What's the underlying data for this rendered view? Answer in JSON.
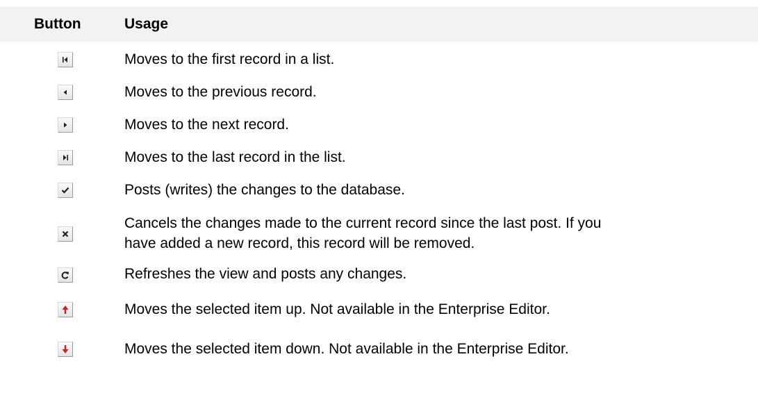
{
  "table": {
    "header": {
      "button": "Button",
      "usage": "Usage"
    },
    "rows": [
      {
        "icon": "first-record-icon",
        "usage": "Moves to the first record in a list."
      },
      {
        "icon": "prior-record-icon",
        "usage": "Moves to the previous record."
      },
      {
        "icon": "next-record-icon",
        "usage": "Moves to the next record."
      },
      {
        "icon": "last-record-icon",
        "usage": "Moves to the last record in the list."
      },
      {
        "icon": "post-checkmark-icon",
        "usage": "Posts (writes) the changes to the database."
      },
      {
        "icon": "cancel-x-icon",
        "usage_line1": "Cancels the changes made to the current record since the last post. If you",
        "usage_line2": "have added a new record, this record will be removed."
      },
      {
        "icon": "refresh-icon",
        "usage": "Refreshes the view and posts any changes."
      },
      {
        "icon": "move-up-arrow-icon",
        "usage": "Moves the selected item up. Not available in the Enterprise Editor."
      },
      {
        "icon": "move-down-arrow-icon",
        "usage": "Moves the selected item down. Not available in the Enterprise Editor."
      }
    ]
  },
  "colors": {
    "header_bg": "#f2f2f2",
    "arrow_red": "#cc1f1f",
    "glyph_dark": "#202020"
  }
}
